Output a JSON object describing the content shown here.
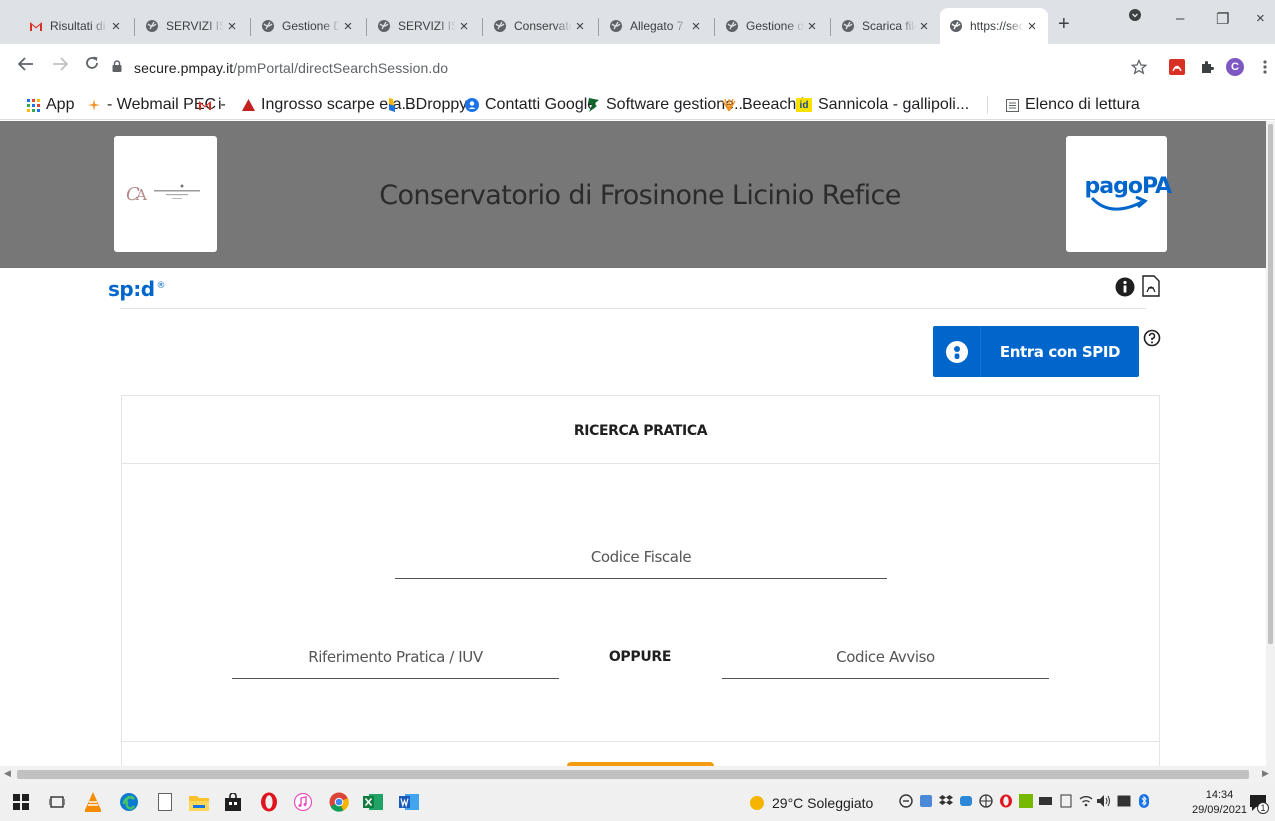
{
  "browser": {
    "tabs": [
      {
        "label": "Risultati di",
        "favicon": "gmail-icon",
        "active": false
      },
      {
        "label": "SERVIZI ISS",
        "favicon": "globe-icon",
        "active": false
      },
      {
        "label": "Gestione D",
        "favicon": "globe-icon",
        "active": false
      },
      {
        "label": "SERVIZI ISS",
        "favicon": "globe-icon",
        "active": false
      },
      {
        "label": "Conservato",
        "favicon": "globe-icon",
        "active": false
      },
      {
        "label": "Allegato 7",
        "favicon": "globe-icon",
        "active": false
      },
      {
        "label": "Gestione d",
        "favicon": "globe-icon",
        "active": false
      },
      {
        "label": "Scarica file",
        "favicon": "globe-icon",
        "active": false
      },
      {
        "label": "https://sec",
        "favicon": "globe-icon",
        "active": true
      }
    ],
    "tab_close_glyph": "×",
    "new_tab_glyph": "+",
    "window_controls": {
      "minimize": "–",
      "restore": "❐",
      "close": "×"
    },
    "url_host": "secure.pmpay.it",
    "url_path": "/pmPortal/directSearchSession.do",
    "bookmarks": [
      {
        "label": "App",
        "icon": "apps-grid-icon"
      },
      {
        "label": "- Webmail PEC -",
        "icon": "webmail-icon"
      },
      {
        "label": "i",
        "icon": "gmail-icon"
      },
      {
        "label": "Ingrosso scarpe e a...",
        "icon": "triangle-icon"
      },
      {
        "label": "BDroppy",
        "icon": "bdroppy-icon"
      },
      {
        "label": "Contatti Google",
        "icon": "contacts-icon"
      },
      {
        "label": "Software gestione...",
        "icon": "software-icon"
      },
      {
        "label": "Beeach.it",
        "icon": "beeach-icon"
      },
      {
        "label": "Sannicola - gallipoli...",
        "icon": "id-icon"
      }
    ],
    "reading_list": "Elenco di lettura",
    "profile_initial": "C"
  },
  "page": {
    "title": "Conservatorio di Frosinone Licinio Refice",
    "pago_logo": "pagoPA",
    "spid_logo": "sp:d",
    "spid_button": "Entra con SPID",
    "panel_title": "RICERCA PRATICA",
    "codice_fiscale_placeholder": "Codice Fiscale",
    "riferimento_placeholder": "Riferimento Pratica / IUV",
    "oppure": "OPPURE",
    "codice_avviso_placeholder": "Codice Avviso",
    "colors": {
      "header_bg": "#777777",
      "spid_blue": "#0066cc",
      "search_orange": "#f39c12"
    }
  },
  "taskbar": {
    "weather": "29°C Soleggiato",
    "time": "14:34",
    "date": "29/09/2021",
    "notification_count": "1"
  }
}
